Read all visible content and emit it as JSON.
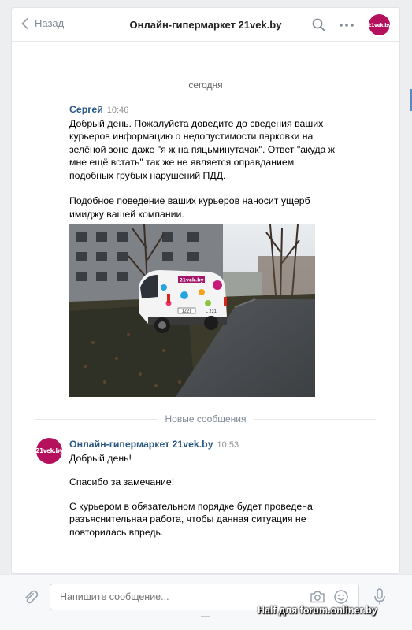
{
  "header": {
    "back_label": "Назад",
    "title": "Онлайн-гипермаркет 21vek.by",
    "avatar_text": "21vek.by"
  },
  "conversation": {
    "date_separator": "сегодня",
    "messages": [
      {
        "author": "Сергей",
        "time": "10:46",
        "paragraphs": [
          "Добрый день. Пожалуйста доведите до сведения ваших курьеров информацию о недопустимости парковки на зелёной зоне даже \"я ж на пяцьминутачак\". Ответ \"акуда ж мне ещё встать\" так же не является оправданием подобных грубых нарушений ПДД.",
          "Подобное поведение ваших курьеров наносит ущерб имиджу вашей компании."
        ],
        "photo": {
          "van_sign": "21vek.by",
          "plate": "1221",
          "side_number": "L 221"
        }
      }
    ],
    "new_messages_label": "Новые сообщения",
    "reply": {
      "author": "Онлайн-гипермаркет 21vek.by",
      "time": "10:53",
      "avatar_text": "21vek.by",
      "paragraphs": [
        "Добрый день!",
        "Спасибо за замечание!",
        "С курьером в обязательном порядке будет проведена разъяснительная работа, чтобы данная ситуация не повторилась впредь."
      ]
    }
  },
  "composer": {
    "placeholder": "Напишите сообщение..."
  },
  "watermark": "Half для forum.onliner.by",
  "colors": {
    "accent": "#2a5885",
    "brand": "#b4105c",
    "muted": "#828a99"
  },
  "icons": [
    "chevron-left-icon",
    "search-icon",
    "more-icon",
    "paperclip-icon",
    "camera-icon",
    "smile-icon",
    "microphone-icon"
  ]
}
